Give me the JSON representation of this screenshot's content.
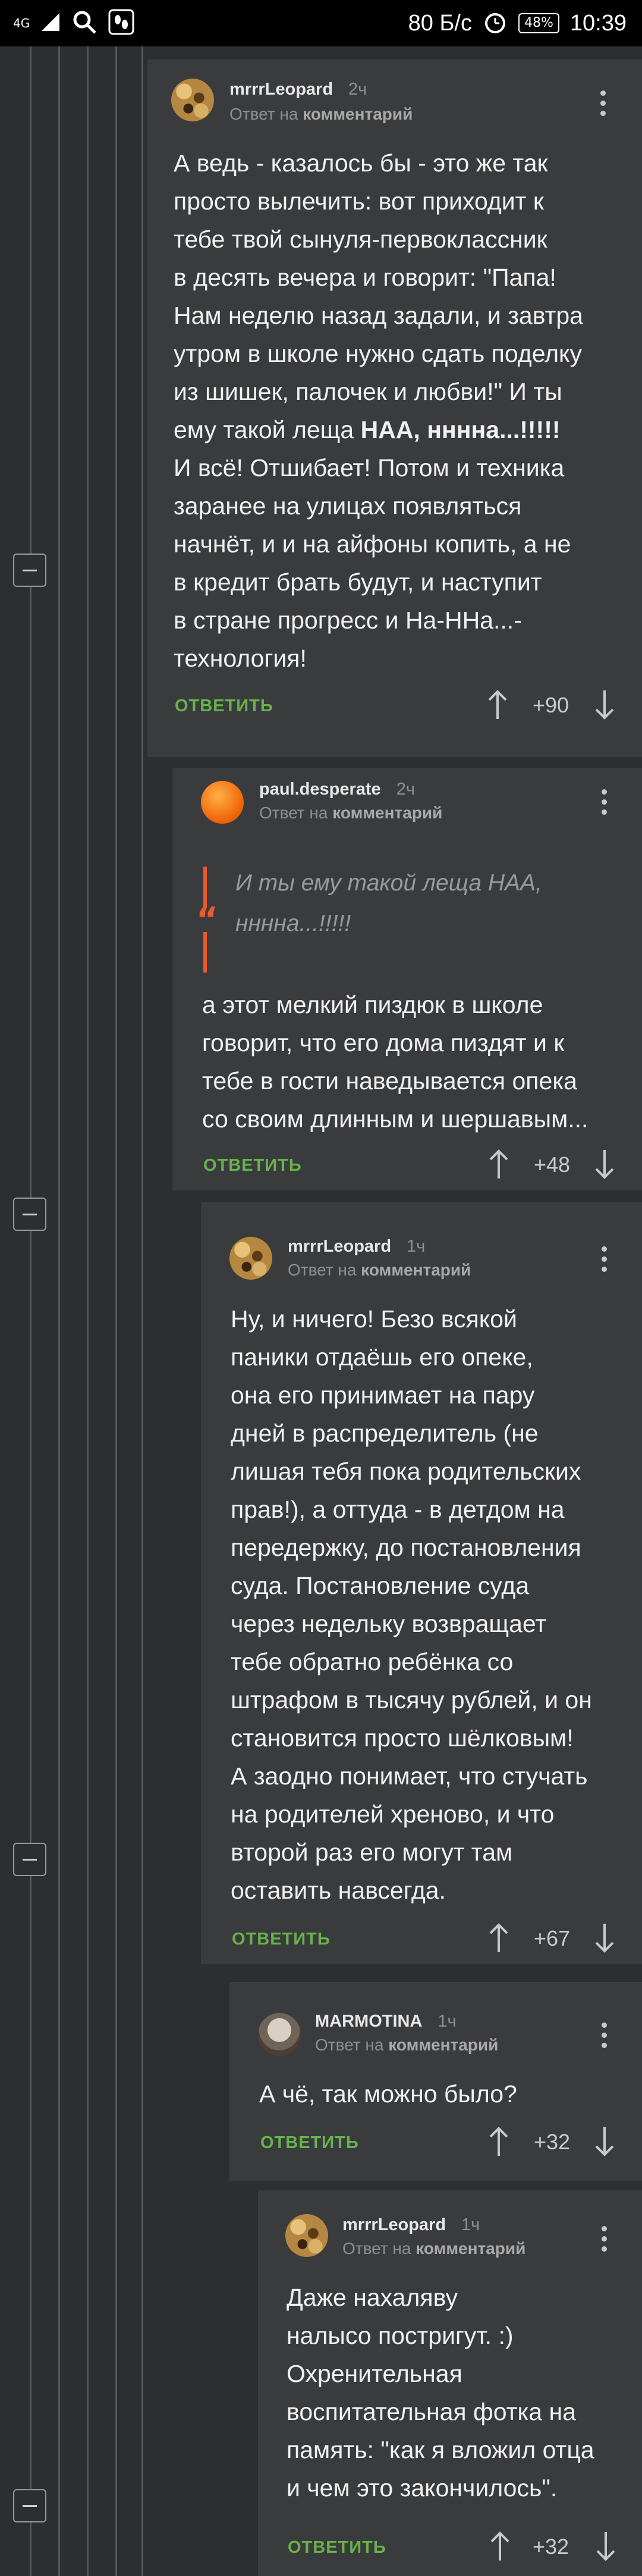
{
  "status_bar": {
    "network": "4G",
    "speed": "80 Б/с",
    "battery": "48%",
    "time": "10:39"
  },
  "comments": [
    {
      "author": "mrrrLeopard",
      "time": "2ч",
      "reply_prefix": "Ответ на",
      "reply_target": "комментарий",
      "text_before_bold": "А ведь - казалось бы - это же так\nпросто вылечить: вот приходит к\nтебе твой сынуля-первоклассник\nв десять вечера и говорит: \"Папа!\nНам неделю назад задали, и завтра\nутром в школе нужно сдать поделку\nиз шишек, палочек и любви!\" И ты\nему такой леща ",
      "text_bold": "НАА, ннннa...!!!!!",
      "text_after_bold": "\nИ всё! Отшибает! Потом и техника\nзаранее на улицах появляться\nначнёт, и и на айфоны копить, а не\nв кредит брать будут, и наступит\nв стране прогресс и На-ННа...-\nтехнология!",
      "reply_label": "ОТВЕТИТЬ",
      "score": "+90"
    },
    {
      "author": "paul.desperate",
      "time": "2ч",
      "reply_prefix": "Ответ на",
      "reply_target": "комментарий",
      "quote": "И ты ему такой леща НАА,\nннннa...!!!!!",
      "text": "а этот мелкий пиздюк в школе\nговорит, что его дома пиздят и к\nтебе в гости наведывается опека\nсо своим длинным и шершавым...",
      "reply_label": "ОТВЕТИТЬ",
      "score": "+48"
    },
    {
      "author": "mrrrLeopard",
      "time": "1ч",
      "reply_prefix": "Ответ на",
      "reply_target": "комментарий",
      "text": "Ну, и ничего! Безо всякой\nпаники отдаёшь его опеке,\nона его принимает на пару\nдней в распределитель (не\nлишая тебя пока родительских\nправ!), а оттуда - в детдом на\nпередержку, до постановления\nсуда. Постановление суда\nчерез недельку возвращает\nтебе обратно ребёнка со\nштрафом в тысячу рублей, и он\nстановится просто шёлковым!\nА заодно понимает, что стучать\nна родителей хреново, и что\nвторой раз его могут там\nоставить навсегда.",
      "reply_label": "ОТВЕТИТЬ",
      "score": "+67"
    },
    {
      "author": "MARMOTINA",
      "time": "1ч",
      "reply_prefix": "Ответ на",
      "reply_target": "комментарий",
      "text": "А чё, так можно было?",
      "reply_label": "ОТВЕТИТЬ",
      "score": "+32"
    },
    {
      "author": "mrrrLeopard",
      "time": "1ч",
      "reply_prefix": "Ответ на",
      "reply_target": "комментарий",
      "text": "Даже нахаляву\nналысо постригут. :)\nОхренительная\nвоспитательная фотка на\nпамять: \"как я вложил отца\nи чем это закончилось\".",
      "reply_label": "ОТВЕТИТЬ",
      "score": "+32"
    }
  ],
  "icons": {
    "upvote": "arrow-up-icon",
    "downvote": "arrow-down-icon",
    "more": "kebab-menu-icon",
    "collapse": "collapse-minus-icon"
  },
  "colors": {
    "reply_green": "#67b34b",
    "quote_accent": "#e85b2e",
    "background": "#2d2e30",
    "card": "#3a3b3d"
  }
}
